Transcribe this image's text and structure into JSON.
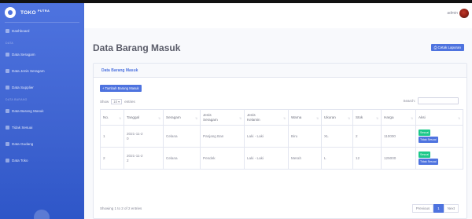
{
  "brand": {
    "name": "TOKO",
    "sup": "PUTRA"
  },
  "sidebar": {
    "items": [
      {
        "label": "Dashboard"
      },
      {
        "label": "Data Seragam"
      },
      {
        "label": "Data Jenis Seragam"
      },
      {
        "label": "Data Supplier"
      },
      {
        "label": "Data Barang Masuk"
      },
      {
        "label": "Tidak Sesuai"
      },
      {
        "label": "Data Gudang"
      },
      {
        "label": "Data Toko"
      }
    ],
    "heading_master": "DATA",
    "heading_transaksi": "DATA BARANG"
  },
  "topbar": {
    "user": "admin"
  },
  "page": {
    "title": "Data Barang Masuk",
    "report_button": "⎙ Cetak Laporan"
  },
  "card": {
    "header": "Data Barang Masuk",
    "add_button": "+ Tambah Barang Masuk",
    "show_prefix": "Show",
    "show_value": "10",
    "show_suffix": "entries",
    "search_label": "Search:"
  },
  "table": {
    "headers": [
      "No.",
      "Tanggal",
      "Seragam",
      "Jenis Seragam",
      "Jenis Kelamin",
      "Warna",
      "Ukuran",
      "Stok",
      "Harga",
      "Aksi"
    ],
    "rows": [
      {
        "no": "1",
        "tanggal": "2021-11-20",
        "seragam": "Celana",
        "jenis": "Panjang Ban",
        "kelamin": "Laki - Laki",
        "warna": "Biru",
        "ukuran": "XL",
        "stok": "2",
        "harga": "110000",
        "btn1": "Sesuai",
        "btn2": "Tidak Sesuai"
      },
      {
        "no": "2",
        "tanggal": "2021-11-22",
        "seragam": "Celana",
        "jenis": "Pendek",
        "kelamin": "Laki - Laki",
        "warna": "Merah",
        "ukuran": "L",
        "stok": "12",
        "harga": "125000",
        "btn1": "Sesuai",
        "btn2": "Tidak Sesuai"
      }
    ]
  },
  "footer": {
    "info": "Showing 1 to 2 of 2 entries",
    "prev": "Previous",
    "page": "1",
    "next": "Next"
  },
  "colors": {
    "primary": "#4e73df",
    "success": "#1cc88a"
  }
}
